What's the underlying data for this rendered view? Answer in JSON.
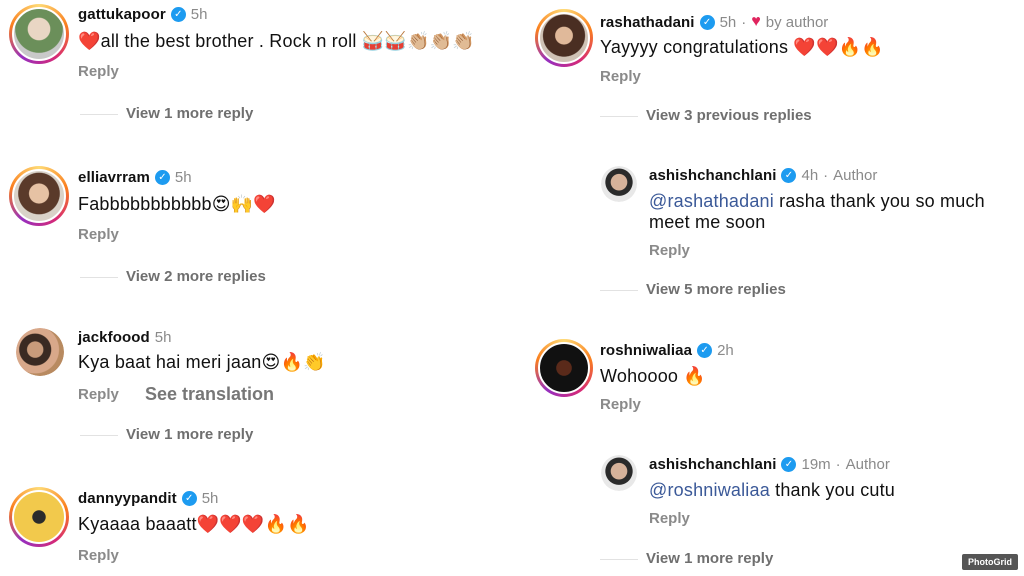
{
  "left": {
    "comments": [
      {
        "username": "gattukapoor",
        "time": "5h",
        "text": "❤️all the best brother . Rock n roll 🥁🥁👏🏼👏🏼👏🏼",
        "reply": "Reply",
        "view_more": "View 1 more reply"
      },
      {
        "username": "elliavrram",
        "time": "5h",
        "text": "Fabbbbbbbbbbb😍🙌❤️",
        "reply": "Reply",
        "view_more": "View 2 more replies"
      },
      {
        "username": "jackfoood",
        "time": "5h",
        "text": "Kya baat hai meri jaan😍🔥👏",
        "reply": "Reply",
        "translate": "See translation",
        "view_more": "View 1 more reply"
      },
      {
        "username": "dannyypandit",
        "time": "5h",
        "text": "Kyaaaa baaatt❤️❤️❤️🔥🔥",
        "reply": "Reply"
      }
    ]
  },
  "right": {
    "top": {
      "username": "rashathadani",
      "time": "5h",
      "liked_by": "by author",
      "text": "Yayyyy congratulations ❤️❤️🔥🔥",
      "reply": "Reply",
      "view_prev": "View 3 previous replies"
    },
    "reply1": {
      "username": "ashishchanchlani",
      "time": "4h",
      "role": "Author",
      "mention": "@rashathadani",
      "text1": " rasha thank you so much",
      "text2": "meet me soon",
      "reply": "Reply",
      "view_more": "View 5 more replies"
    },
    "second": {
      "username": "roshniwaliaa",
      "time": "2h",
      "text": "Wohoooo 🔥",
      "reply": "Reply"
    },
    "reply2": {
      "username": "ashishchanchlani",
      "time": "19m",
      "role": "Author",
      "mention": "@roshniwaliaa",
      "text1": " thank you cutu",
      "reply": "Reply",
      "view_more": "View 1 more reply"
    }
  },
  "watermark": "PhotoGrid",
  "icons": {
    "verified": "verified-badge-icon",
    "heart": "heart-icon"
  },
  "colors": {
    "verified": "#1d9bf0",
    "heart": "#e0245e",
    "mention": "#3b5998"
  }
}
